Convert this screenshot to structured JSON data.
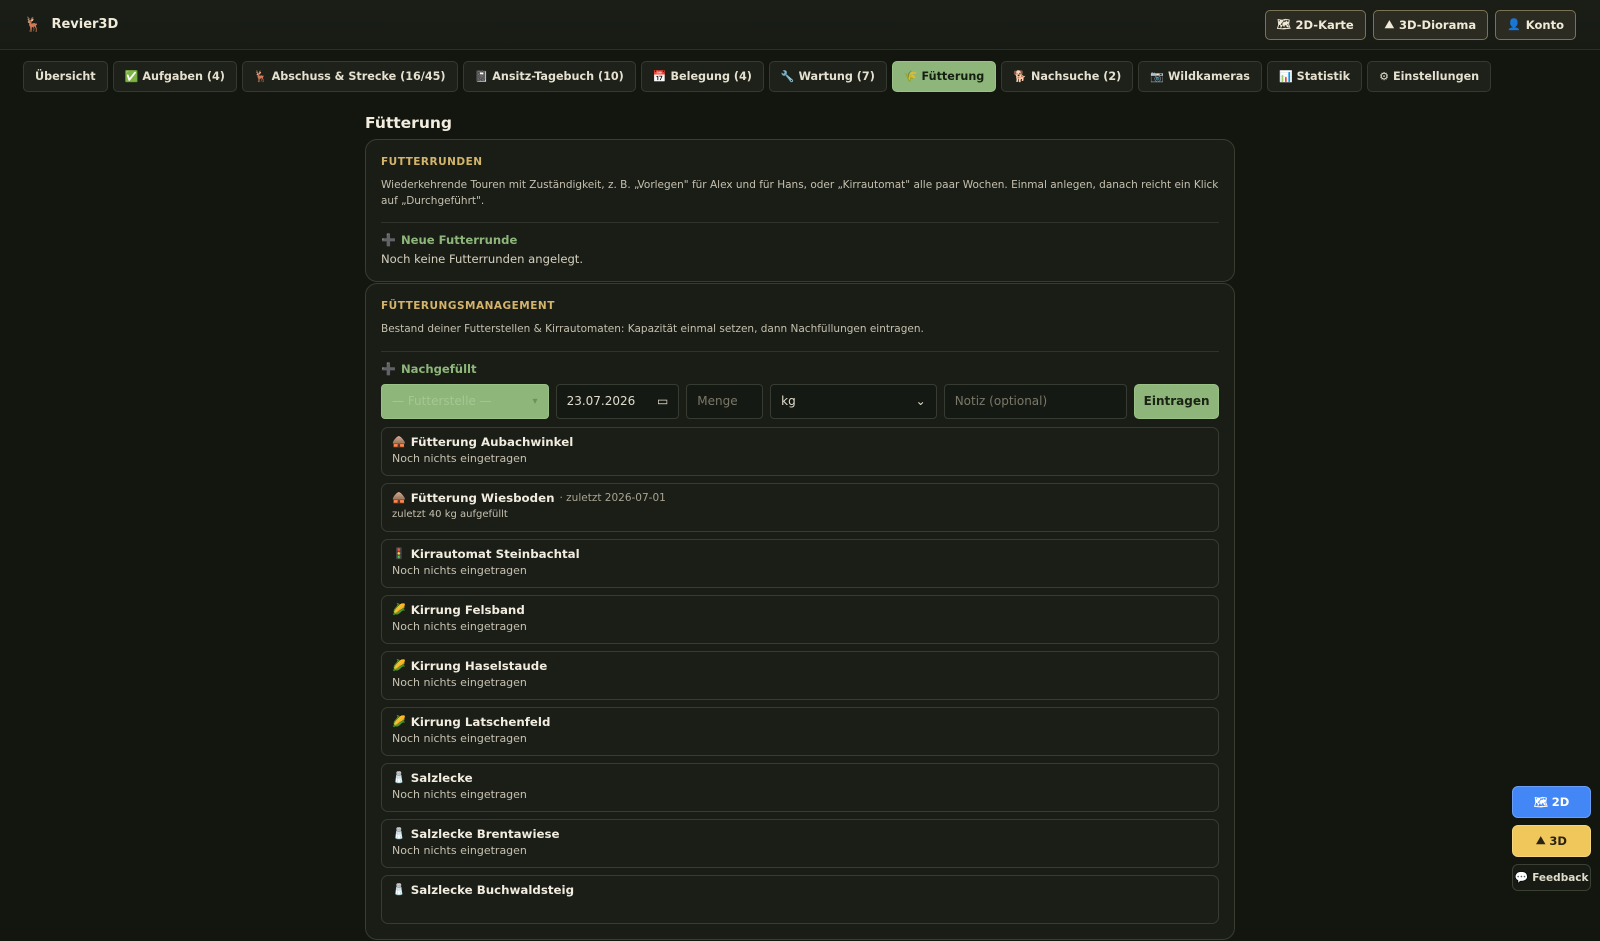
{
  "app": {
    "name": "Revier3D",
    "logo_icon": "🦌"
  },
  "top_actions": [
    {
      "label": "2D-Karte",
      "icon": "🗺"
    },
    {
      "label": "3D-Diorama",
      "icon": "⛰"
    },
    {
      "label": "Konto",
      "icon": "👤"
    }
  ],
  "tabs": [
    {
      "label": "Übersicht",
      "icon": ""
    },
    {
      "label": "Aufgaben (4)",
      "icon": "✅"
    },
    {
      "label": "Abschuss & Strecke (16/45)",
      "icon": "🦌"
    },
    {
      "label": "Ansitz-Tagebuch (10)",
      "icon": "📓"
    },
    {
      "label": "Belegung (4)",
      "icon": "📅"
    },
    {
      "label": "Wartung (7)",
      "icon": "🔧"
    },
    {
      "label": "Fütterung",
      "icon": "🌾",
      "active": true
    },
    {
      "label": "Nachsuche (2)",
      "icon": "🐕"
    },
    {
      "label": "Wildkameras",
      "icon": "📷"
    },
    {
      "label": "Statistik",
      "icon": "📊"
    },
    {
      "label": "Einstellungen",
      "icon": "⚙"
    }
  ],
  "page": {
    "title": "Fütterung"
  },
  "futterrunden": {
    "title": "Futterrunden",
    "description": "Wiederkehrende Touren mit Zuständigkeit, z. B. „Vorlegen\" für Alex und für Hans, oder „Kirrautomat\" alle paar Wochen. Einmal anlegen, danach reicht ein Klick auf „Durchgeführt\".",
    "add_label": "Neue Futterrunde",
    "add_icon": "➕",
    "empty_text": "Noch keine Futterrunden angelegt."
  },
  "management": {
    "title": "Fütterungsmanagement",
    "description": "Bestand deiner Futterstellen & Kirrautomaten: Kapazität einmal setzen, dann Nachfüllungen eintragen.",
    "add_label": "Nachgefüllt",
    "add_icon": "➕",
    "form": {
      "station_placeholder": "— Futterstelle —",
      "date_value": "23.07.2026",
      "menge_placeholder": "Menge",
      "unit_value": "kg",
      "notiz_placeholder": "Notiz (optional)",
      "submit_label": "Eintragen"
    },
    "items": [
      {
        "icon": "🛖",
        "name": "Fütterung Aubachwinkel",
        "meta": "",
        "sub": "Noch nichts eingetragen"
      },
      {
        "icon": "🛖",
        "name": "Fütterung Wiesboden",
        "meta": "· zuletzt 2026-07-01",
        "sub": "zuletzt 40 kg aufgefüllt"
      },
      {
        "icon": "🚦",
        "name": "Kirrautomat Steinbachtal",
        "meta": "",
        "sub": "Noch nichts eingetragen"
      },
      {
        "icon": "🌽",
        "name": "Kirrung Felsband",
        "meta": "",
        "sub": "Noch nichts eingetragen"
      },
      {
        "icon": "🌽",
        "name": "Kirrung Haselstaude",
        "meta": "",
        "sub": "Noch nichts eingetragen"
      },
      {
        "icon": "🌽",
        "name": "Kirrung Latschenfeld",
        "meta": "",
        "sub": "Noch nichts eingetragen"
      },
      {
        "icon": "🧂",
        "name": "Salzlecke",
        "meta": "",
        "sub": "Noch nichts eingetragen"
      },
      {
        "icon": "🧂",
        "name": "Salzlecke Brentawiese",
        "meta": "",
        "sub": "Noch nichts eingetragen"
      },
      {
        "icon": "🧂",
        "name": "Salzlecke Buchwaldsteig",
        "meta": "",
        "sub": ""
      }
    ]
  },
  "fabs": [
    {
      "label": "2D",
      "icon": "🗺"
    },
    {
      "label": "3D",
      "icon": "⛰"
    },
    {
      "label": "Feedback",
      "icon": "💬"
    }
  ]
}
